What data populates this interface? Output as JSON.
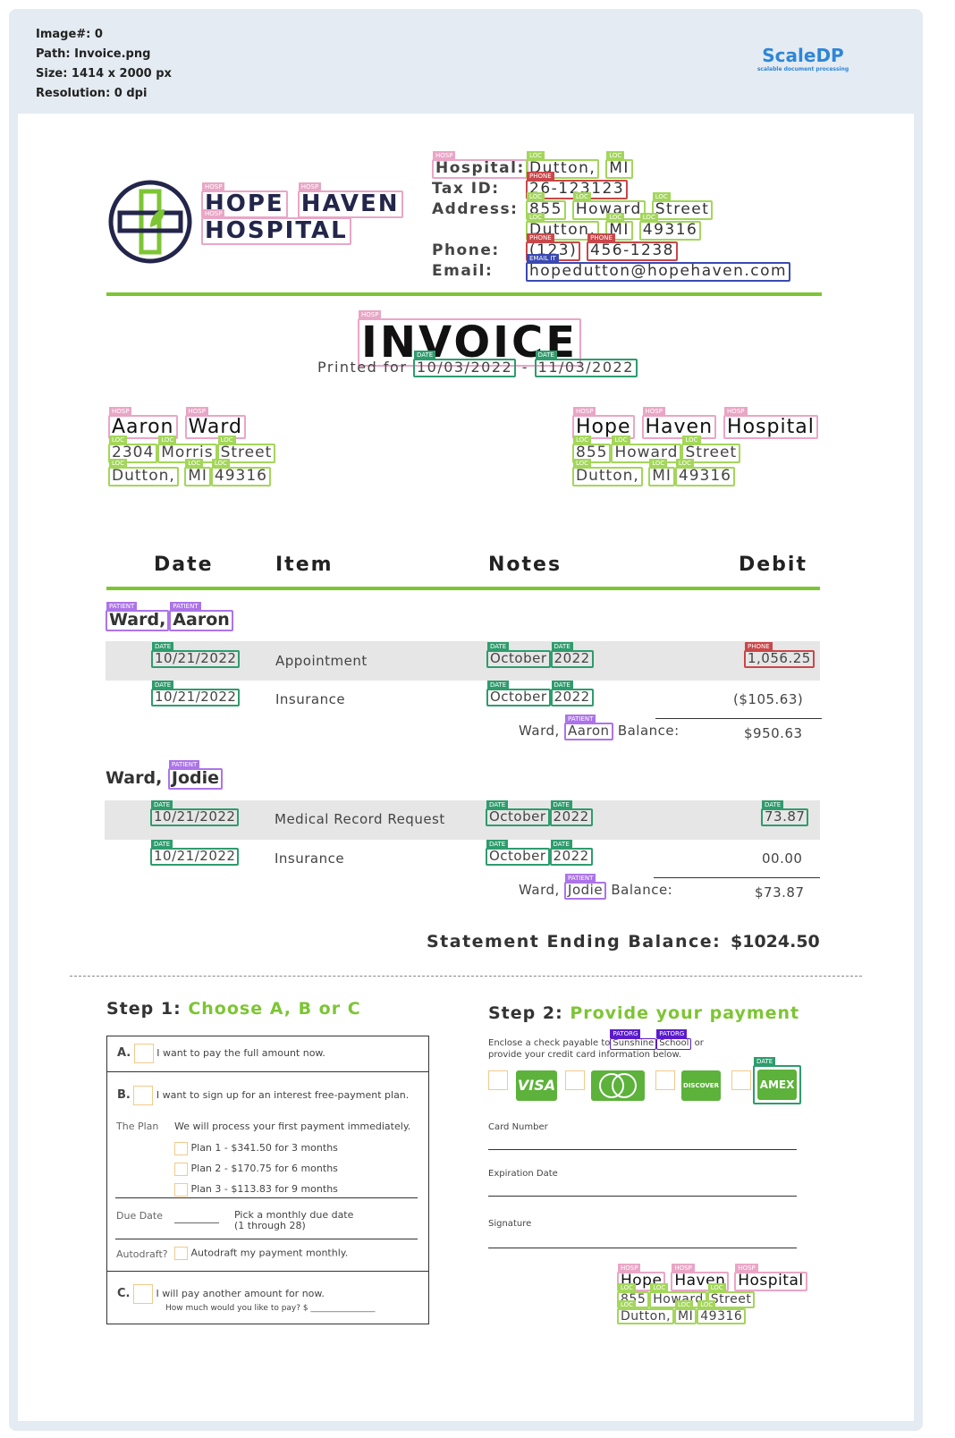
{
  "meta": {
    "image": "Image#: 0",
    "path": "Path: Invoice.png",
    "size": "Size: 1414 x 2000 px",
    "resolution": "Resolution: 0 dpi"
  },
  "brand": {
    "name": "ScaleDP",
    "sub": "scalable document processing"
  },
  "tags": {
    "hosp": "HOSP",
    "loc": "LOC",
    "phone": "PHONE",
    "email": "EMAIL IT",
    "date": "DATE",
    "patient": "PATIENT",
    "patorg": "PATORG"
  },
  "logo": {
    "line1a": "HOPE",
    "line1b": "HAVEN",
    "line2": "HOSPITAL"
  },
  "hospital_info": {
    "label_hospital": "Hospital:",
    "city": "Dutton,",
    "state": "MI",
    "label_tax": "Tax ID:",
    "tax_id": "26-123123",
    "label_address": "Address:",
    "street_no": "855",
    "street_name": "Howard",
    "street_type": "Street",
    "city2": "Dutton,",
    "state2": "MI",
    "zip": "49316",
    "label_phone": "Phone:",
    "phone_area": "(123)",
    "phone_num": "456-1238",
    "label_email": "Email:",
    "email": "hopedutton@hopehaven.com"
  },
  "invoice": {
    "title": "INVOICE",
    "printed_for": "Printed for",
    "date_from": "10/03/2022",
    "dash": "-",
    "date_to": "11/03/2022"
  },
  "bill_to": {
    "first": "Aaron",
    "last": "Ward",
    "no": "2304",
    "street": "Morris",
    "type": "Street",
    "city": "Dutton,",
    "state": "MI",
    "zip": "49316"
  },
  "bill_from": {
    "w1": "Hope",
    "w2": "Haven",
    "w3": "Hospital",
    "no": "855",
    "street": "Howard",
    "type": "Street",
    "city": "Dutton,",
    "state": "MI",
    "zip": "49316"
  },
  "table": {
    "headers": [
      "Date",
      "Item",
      "Notes",
      "Debit"
    ]
  },
  "patients": [
    {
      "last": "Ward,",
      "first": "Aaron",
      "rows": [
        {
          "date": "10/21/2022",
          "item": "Appointment",
          "month": "October",
          "year": "2022",
          "debit": "1,056.25"
        },
        {
          "date": "10/21/2022",
          "item": "Insurance",
          "month": "October",
          "year": "2022",
          "debit": "($105.63)"
        }
      ],
      "balance_prefix": "Ward,",
      "balance_name": "Aaron",
      "balance_label": "Balance:",
      "balance": "$950.63"
    },
    {
      "last": "Ward,",
      "first": "Jodie",
      "rows": [
        {
          "date": "10/21/2022",
          "item": "Medical Record Request",
          "month": "October",
          "year": "2022",
          "debit": "73.87"
        },
        {
          "date": "10/21/2022",
          "item": "Insurance",
          "month": "October",
          "year": "2022",
          "debit": "00.00"
        }
      ],
      "balance_prefix": "Ward,",
      "balance_name": "Jodie",
      "balance_label": "Balance:",
      "balance": "$73.87"
    }
  ],
  "statement": {
    "label": "Statement Ending Balance:",
    "value": "$1024.50"
  },
  "step1": {
    "title_prefix": "Step 1:",
    "title_accent": "Choose A, B or C",
    "a_letter": "A.",
    "a_text": "I want to pay the full amount now.",
    "b_letter": "B.",
    "b_text": "I want to sign up for an interest free-payment plan.",
    "plan_label": "The Plan",
    "plan_text": "We will process your first payment immediately.",
    "plans": [
      "Plan 1 - $341.50 for 3 months",
      "Plan 2 - $170.75 for 6 months",
      "Plan 3 - $113.83 for 9 months"
    ],
    "due_label": "Due Date",
    "due_text1": "Pick a monthly due date",
    "due_text2": "(1 through 28)",
    "auto_label": "Autodraft?",
    "auto_text": "Autodraft my payment monthly.",
    "c_letter": "C.",
    "c_text": "I will pay another amount for now.",
    "c_sub": "How much would you like to pay? $ ________________"
  },
  "step2": {
    "title_prefix": "Step 2:",
    "title_accent": "Provide your payment",
    "enclose1": "Enclose a check payable to",
    "org1": "Sunshine",
    "org2": "School",
    "enclose_or": "or",
    "enclose2": "provide your credit card information below.",
    "cards": [
      "VISA",
      "",
      "DISCOVER",
      "AMEX"
    ],
    "card_number": "Card Number",
    "expiration": "Expiration Date",
    "signature": "Signature"
  },
  "footer_addr": {
    "w1": "Hope",
    "w2": "Haven",
    "w3": "Hospital",
    "no": "855",
    "street": "Howard",
    "type": "Street",
    "city": "Dutton,",
    "state": "MI",
    "zip": "49316"
  },
  "colors": {
    "accent_green": "#7dc534",
    "brand_blue": "#2f86d6",
    "logo_navy": "#23264a"
  }
}
